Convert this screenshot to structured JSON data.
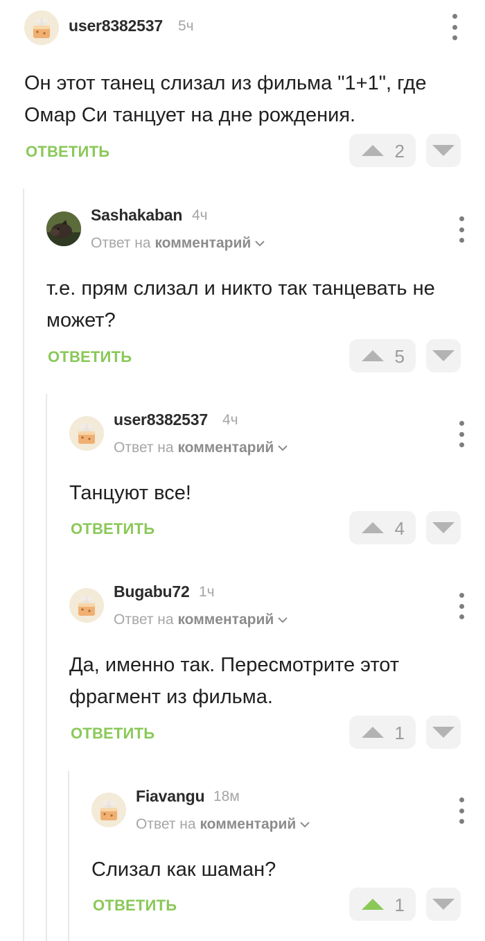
{
  "ui": {
    "reply_label": "Ответ на",
    "reply_target": "комментарий",
    "answer_label": "ОТВЕТИТЬ"
  },
  "colors": {
    "accent_green": "#8ac858",
    "vote_gray": "#b3b3b3",
    "upvoted_green": "#8ac858"
  },
  "comments": [
    {
      "author": "user8382537",
      "time": "5ч",
      "avatar": "cake-avatar",
      "text": "Он этот танец слизал из фильма \"1+1\", где Омар Си танцует на дне рождения.",
      "votes": "2",
      "upvoted": false
    },
    {
      "author": "Sashakaban",
      "time": "4ч",
      "avatar": "boar-photo-avatar",
      "text": "т.е. прям слизал и никто так танцевать не может?",
      "votes": "5",
      "upvoted": false
    },
    {
      "author": "user8382537",
      "time": "4ч",
      "avatar": "cake-avatar",
      "text": "Танцуют все!",
      "votes": "4",
      "upvoted": false
    },
    {
      "author": "Bugabu72",
      "time": "1ч",
      "avatar": "cake-avatar",
      "text": "Да, именно так. Пересмотрите этот фрагмент из фильма.",
      "votes": "1",
      "upvoted": false
    },
    {
      "author": "Fiavangu",
      "time": "18м",
      "avatar": "cake-avatar",
      "text": "Слизал как шаман?",
      "votes": "1",
      "upvoted": true
    }
  ]
}
